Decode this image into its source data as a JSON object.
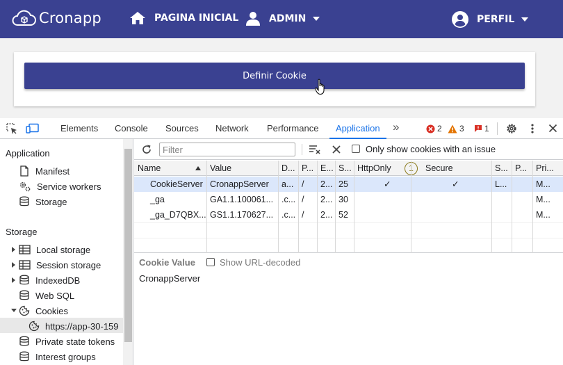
{
  "app": {
    "logo_text": "Cronapp",
    "nav": {
      "home_label": "PAGINA INICIAL",
      "admin_label": "ADMIN",
      "profile_label": "PERFIL"
    },
    "set_cookie_button": "Definir Cookie",
    "brand_color": "#3a4191"
  },
  "devtools": {
    "tabs": [
      "Elements",
      "Console",
      "Sources",
      "Network",
      "Performance",
      "Application"
    ],
    "active_tab": "Application",
    "more_tabs_glyph": "»",
    "errors": "2",
    "warnings": "3",
    "issues": "1",
    "sidebar": {
      "application_heading": "Application",
      "application_items": [
        "Manifest",
        "Service workers",
        "Storage"
      ],
      "storage_heading": "Storage",
      "storage_items": [
        "Local storage",
        "Session storage",
        "IndexedDB",
        "Web SQL",
        "Cookies"
      ],
      "cookie_origin": "https://app-30-159",
      "extra_items": [
        "Private state tokens",
        "Interest groups"
      ]
    },
    "toolbar": {
      "filter_placeholder": "Filter",
      "only_issues_label": "Only show cookies with an issue"
    },
    "table": {
      "columns": [
        "Name",
        "Value",
        "D...",
        "P...",
        "E...",
        "S...",
        "HttpOnly",
        "Secure",
        "S...",
        "P...",
        "Pri..."
      ],
      "info_badge": "1",
      "rows": [
        {
          "name": "CookieServer",
          "value": "CronappServer",
          "domain": "a...",
          "path": "/",
          "expires": "2...",
          "size": "25",
          "httponly": "✓",
          "secure": "✓",
          "samesite": "L...",
          "partition": "",
          "priority": "M..."
        },
        {
          "name": "_ga",
          "value": "GA1.1.100061...",
          "domain": ".c...",
          "path": "/",
          "expires": "2...",
          "size": "30",
          "httponly": "",
          "secure": "",
          "samesite": "",
          "partition": "",
          "priority": "M..."
        },
        {
          "name": "_ga_D7QBX...",
          "value": "GS1.1.170627...",
          "domain": ".c...",
          "path": "/",
          "expires": "2...",
          "size": "52",
          "httponly": "",
          "secure": "",
          "samesite": "",
          "partition": "",
          "priority": "M..."
        }
      ]
    },
    "cookie_value_label": "Cookie Value",
    "show_decoded_label": "Show URL-decoded",
    "cookie_value": "CronappServer"
  }
}
